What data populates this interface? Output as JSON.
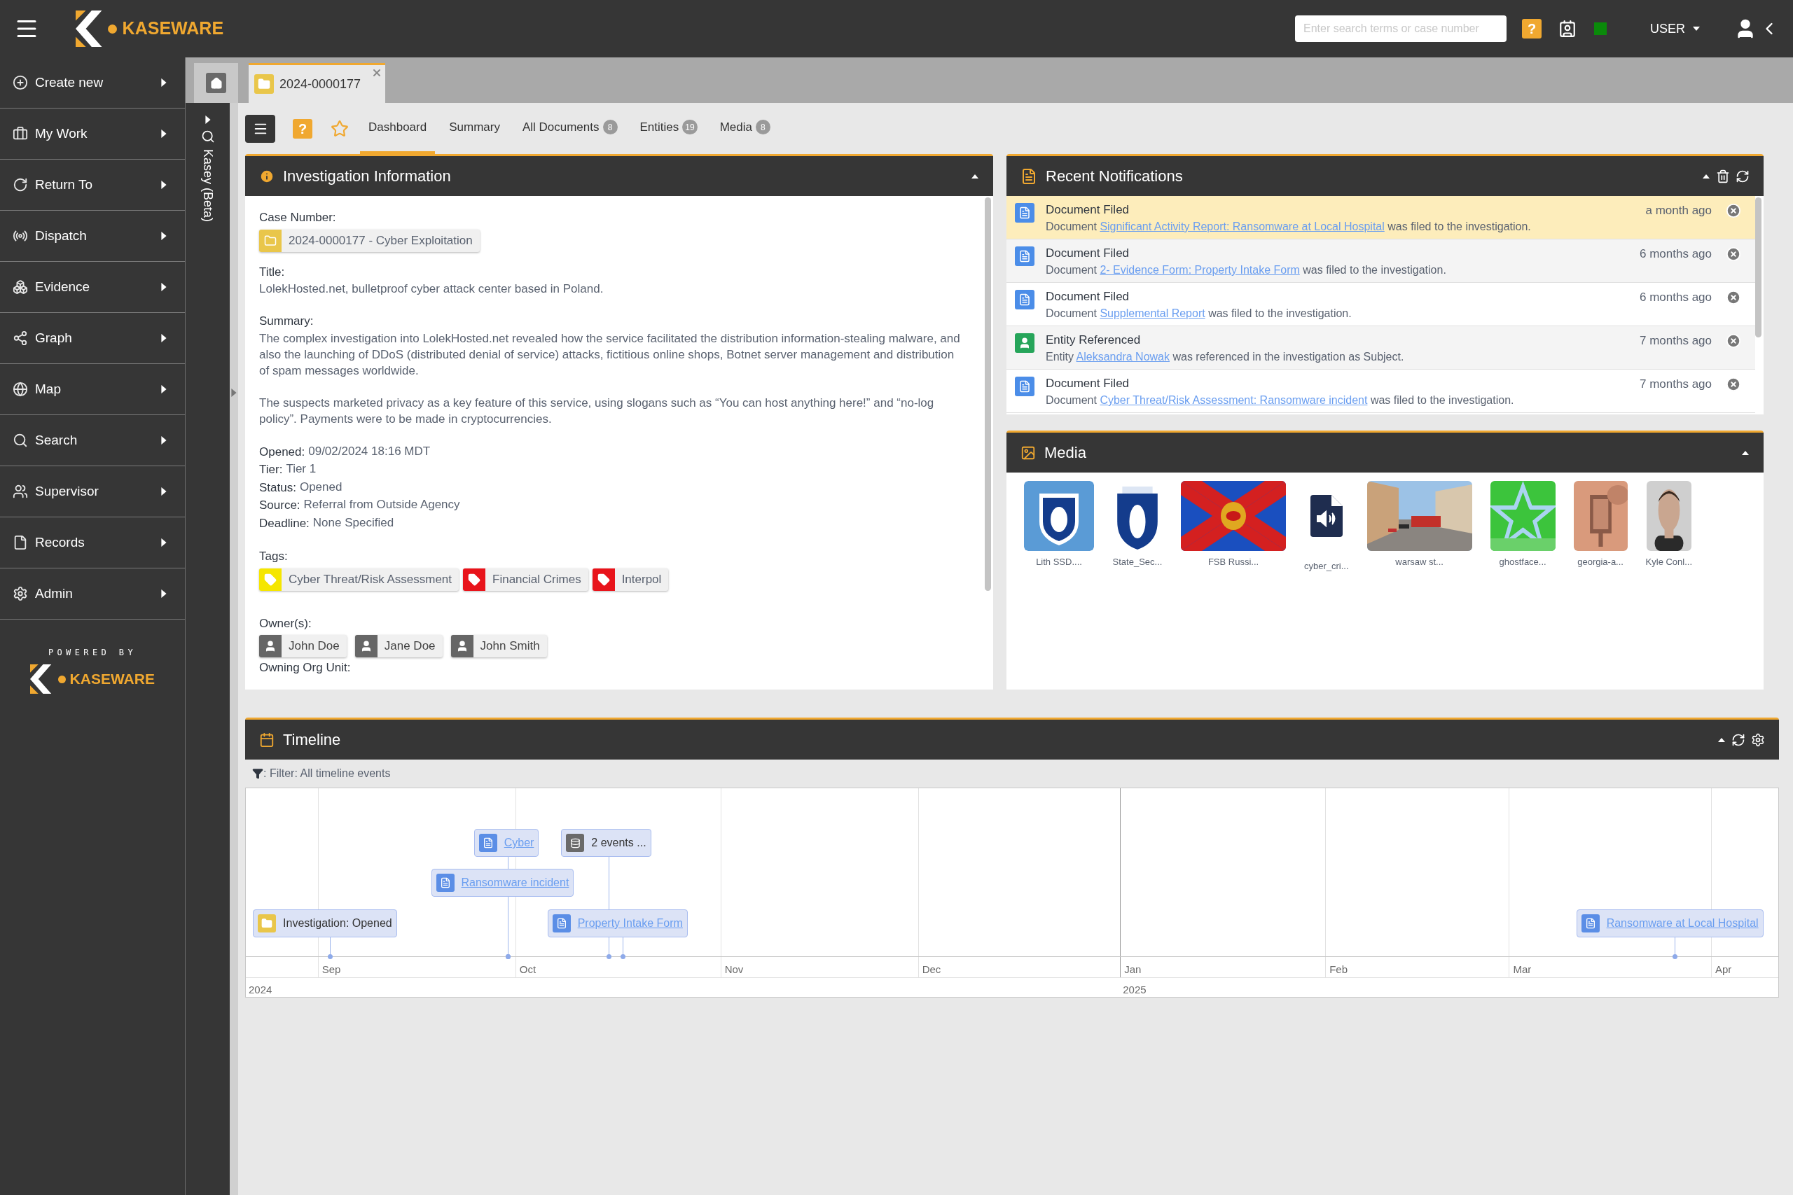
{
  "topbar": {
    "brand": "KASEWARE",
    "search": {
      "placeholder": "Enter search terms or case number"
    },
    "help": "?",
    "user": "USER"
  },
  "sidebar": {
    "items": [
      {
        "label": "Create new"
      },
      {
        "label": "My Work"
      },
      {
        "label": "Return To"
      },
      {
        "label": "Dispatch"
      },
      {
        "label": "Evidence"
      },
      {
        "label": "Graph"
      },
      {
        "label": "Map"
      },
      {
        "label": "Search"
      },
      {
        "label": "Supervisor"
      },
      {
        "label": "Records"
      },
      {
        "label": "Admin"
      }
    ],
    "powered_by": "POWERED BY",
    "brand": "KASEWARE"
  },
  "assistant": {
    "label": "Kasey (Beta)"
  },
  "case_tab": {
    "label": "2024-0000177"
  },
  "toolbar": {
    "help": "?",
    "tabs": [
      {
        "label": "Dashboard",
        "selected": true
      },
      {
        "label": "Summary",
        "selected": false
      },
      {
        "label": "All Documents",
        "badge": "8",
        "selected": false
      },
      {
        "label": "Entities",
        "badge": "19",
        "selected": false
      },
      {
        "label": "Media",
        "badge": "8",
        "selected": false
      }
    ]
  },
  "investigation": {
    "title": "Investigation Information",
    "case_label": "Case Number:",
    "case_number": "2024-0000177 - Cyber Exploitation",
    "title_label": "Title:",
    "title_text": "LolekHosted.net, bulletproof cyber attack center based in Poland.",
    "summary_label": "Summary:",
    "summary": [
      "The complex investigation into LolekHosted.net revealed how the service facilitated the distribution information-stealing malware, and also the launching of DDoS (distributed denial of service) attacks, fictitious online shops, Botnet server management and distribution of spam messages worldwide.",
      "The suspects marketed privacy as a key feature of this service, using slogans such as “You can host anything here!” and “no-log policy”. Payments were to be made in cryptocurrencies."
    ],
    "facts": [
      {
        "label": "Opened:",
        "value": "09/02/2024 18:16 MDT"
      },
      {
        "label": "Tier:",
        "value": "Tier 1"
      },
      {
        "label": "Status:",
        "value": "Opened"
      },
      {
        "label": "Source:",
        "value": "Referral from Outside Agency"
      },
      {
        "label": "Deadline:",
        "value": "None Specified"
      }
    ],
    "tags_label": "Tags:",
    "tags": [
      {
        "label": "Cyber Threat/Risk Assessment",
        "color": "#f5e600"
      },
      {
        "label": "Financial Crimes",
        "color": "#e8141b"
      },
      {
        "label": "Interpol",
        "color": "#e8141b"
      }
    ],
    "owners_label": "Owner(s):",
    "owners": [
      "John Doe",
      "Jane Doe",
      "John Smith"
    ],
    "org_label": "Owning Org Unit:"
  },
  "notifications": {
    "title": "Recent Notifications",
    "items": [
      {
        "kind": "document",
        "title": "Document Filed",
        "before": "Document",
        "link": "Significant Activity Report: Ransomware at Local Hospital",
        "after": "was filed to the investigation.",
        "time": "a month ago",
        "unread": true
      },
      {
        "kind": "document",
        "title": "Document Filed",
        "before": "Document",
        "link": "2- Evidence Form: Property Intake Form",
        "after": "was filed to the investigation.",
        "time": "6 months ago",
        "unread": false
      },
      {
        "kind": "document",
        "title": "Document Filed",
        "before": "Document",
        "link": "Supplemental Report",
        "after": "was filed to the investigation.",
        "time": "6 months ago",
        "unread": false
      },
      {
        "kind": "entity",
        "title": "Entity Referenced",
        "before": "Entity",
        "link": "Aleksandra Nowak",
        "after": "was referenced in the investigation as Subject.",
        "time": "7 months ago",
        "unread": false
      },
      {
        "kind": "document",
        "title": "Document Filed",
        "before": "Document",
        "link": "Cyber Threat/Risk Assessment: Ransomware incident",
        "after": "was filed to the investigation.",
        "time": "7 months ago",
        "unread": false
      }
    ]
  },
  "media": {
    "title": "Media",
    "items": [
      {
        "kind": "picture",
        "label": "Lith SSD...."
      },
      {
        "kind": "picture",
        "label": "State_Sec..."
      },
      {
        "kind": "picture",
        "label": "FSB Russi..."
      },
      {
        "kind": "audio",
        "label": "cyber_cri..."
      },
      {
        "kind": "picture",
        "label": "warsaw st..."
      },
      {
        "kind": "picture",
        "label": "ghostface..."
      },
      {
        "kind": "picture",
        "label": "georgia-a..."
      },
      {
        "kind": "picture",
        "label": "Kyle Conl..."
      }
    ]
  },
  "timeline": {
    "title": "Timeline",
    "filter": ": Filter: All timeline events",
    "events": [
      {
        "kind": "investigation",
        "label": "Investigation: Opened"
      },
      {
        "kind": "document",
        "label": "Cyber"
      },
      {
        "kind": "document",
        "label": "Ransomware incident"
      },
      {
        "kind": "group",
        "label": "2 events ..."
      },
      {
        "kind": "document",
        "label": "Property Intake Form"
      },
      {
        "kind": "document",
        "label": "Ransomware at Local Hospital"
      }
    ],
    "months": [
      "Sep",
      "Oct",
      "Nov",
      "Dec",
      "Jan",
      "Feb",
      "Mar",
      "Apr"
    ],
    "years": [
      "2024",
      "2025"
    ]
  }
}
